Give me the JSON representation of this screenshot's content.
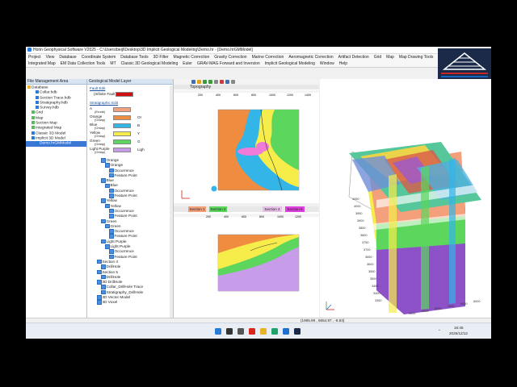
{
  "window": {
    "title": "Horin Geophysical Software V2025 - C:\\Users\\beijl\\Desktop\\3D Implicit Geological Modeling\\Demo.hr - [Demo.hrGMModel]"
  },
  "menu": {
    "row1": [
      "Project",
      "View",
      "Database",
      "Coordinate System",
      "Database Tools",
      "3D Filter",
      "Magnetic Correction",
      "Gravity Correction",
      "Marine Correction",
      "Aeromagnetic Correction",
      "Artifact Detection",
      "Grid",
      "Map",
      "Map Drawing Tools"
    ],
    "row2": [
      "Integrated Map",
      "EM Data Collection Tools",
      "MT",
      "Classic 3D Geological Modeling",
      "Euler",
      "GRAV-MAG Forward and Inversion",
      "Implicit Geological Modeling",
      "Window",
      "Help"
    ]
  },
  "file_panel": {
    "title": "File Management Area",
    "items": [
      {
        "label": "Database",
        "indent": 0,
        "icon": "folder-icon"
      },
      {
        "label": "Collar.hdb",
        "indent": 2,
        "icon": "db-icon"
      },
      {
        "label": "Section Trace.hdb",
        "indent": 2,
        "icon": "db-icon"
      },
      {
        "label": "Stratigraphy.hdb",
        "indent": 2,
        "icon": "db-icon"
      },
      {
        "label": "Survey.hdb",
        "indent": 2,
        "icon": "db-icon"
      },
      {
        "label": "Grid",
        "indent": 1,
        "icon": "grid-icon"
      },
      {
        "label": "Map",
        "indent": 1,
        "icon": "map-icon"
      },
      {
        "label": "Section Map",
        "indent": 1,
        "icon": "map-icon"
      },
      {
        "label": "Integrated Map",
        "indent": 1,
        "icon": "map-icon"
      },
      {
        "label": "Classic 3D Model",
        "indent": 1,
        "icon": "model-icon"
      },
      {
        "label": "Implicit 3D Model",
        "indent": 1,
        "icon": "model-icon"
      },
      {
        "label": "Demo.hrGMModel",
        "indent": 2,
        "icon": "model-icon",
        "selected": true
      }
    ]
  },
  "geo_panel": {
    "title": "Geological Model Layer",
    "fault_header": "Fault Edit",
    "fault_item": "(Infinite Fault)",
    "strat_header": "Stratigraphic Edit",
    "strat_rows": [
      {
        "label": "A",
        "sub": "(Erode)",
        "color": "#f4a07a",
        "right": ""
      },
      {
        "label": "Orange",
        "sub": "(Onlap)",
        "color": "#f08c40",
        "right": "Or"
      },
      {
        "label": "Blue",
        "sub": "(Onlap)",
        "color": "#33b5e8",
        "right": "B"
      },
      {
        "label": "Yellow",
        "sub": "(Onlap)",
        "color": "#f6ec4a",
        "right": "Y"
      },
      {
        "label": "Green",
        "sub": "(Onlap)",
        "color": "#5cd65c",
        "right": "G"
      },
      {
        "label": "Light Purple",
        "sub": "(Onlap)",
        "color": "#c79ce8",
        "right": "Ligh"
      }
    ],
    "tree": [
      {
        "label": "Orange",
        "indent": 1
      },
      {
        "label": "Orange",
        "indent": 2
      },
      {
        "label": "Occurrence",
        "indent": 3
      },
      {
        "label": "Feature Point",
        "indent": 3
      },
      {
        "label": "Blue",
        "indent": 1
      },
      {
        "label": "Blue",
        "indent": 2
      },
      {
        "label": "Occurrence",
        "indent": 3
      },
      {
        "label": "Feature Point",
        "indent": 3
      },
      {
        "label": "Yellow",
        "indent": 1
      },
      {
        "label": "Yellow",
        "indent": 2
      },
      {
        "label": "Occurrence",
        "indent": 3
      },
      {
        "label": "Feature Point",
        "indent": 3
      },
      {
        "label": "Green",
        "indent": 1
      },
      {
        "label": "Green",
        "indent": 2
      },
      {
        "label": "Occurrence",
        "indent": 3
      },
      {
        "label": "Feature Point",
        "indent": 3
      },
      {
        "label": "Light Purple",
        "indent": 1
      },
      {
        "label": "Light Purple",
        "indent": 2
      },
      {
        "label": "Occurrence",
        "indent": 3
      },
      {
        "label": "Feature Point",
        "indent": 3
      },
      {
        "label": "Section 4",
        "indent": 0
      },
      {
        "label": "DrillHole",
        "indent": 1
      },
      {
        "label": "Section 5",
        "indent": 0
      },
      {
        "label": "DrillHole",
        "indent": 1
      },
      {
        "label": "3D DrillHole",
        "indent": 0
      },
      {
        "label": "Collar_DrillHole Trace",
        "indent": 1
      },
      {
        "label": "Stratigraphy_DrillHole",
        "indent": 1
      },
      {
        "label": "3D Vector Model",
        "indent": 0
      },
      {
        "label": "3D Voxel",
        "indent": 0
      }
    ]
  },
  "topography": {
    "title": "Topography",
    "xticks": [
      "200",
      "400",
      "600",
      "800",
      "1000",
      "1200",
      "1400"
    ]
  },
  "sections": {
    "tabs": [
      {
        "label": "Section 1",
        "color": "#f4a07a"
      },
      {
        "label": "Section 2",
        "color": "#5cd65c"
      },
      {
        "label": "Section 4",
        "color": "#e8c0e8"
      },
      {
        "label": "Section 5",
        "color": "#e040e0"
      }
    ],
    "xticks": [
      "200",
      "400",
      "600",
      "800",
      "1000",
      "1200"
    ]
  },
  "view3d": {
    "axis_labels": [
      "4050",
      "4000",
      "3950",
      "3900",
      "3850",
      "3800",
      "3750",
      "3700",
      "3650",
      "3600",
      "3550",
      "3500",
      "3450",
      "3400",
      "3350"
    ],
    "bottom_labels": [
      "1000",
      "2000",
      "3000",
      "4000",
      "5000",
      "6000"
    ]
  },
  "status": {
    "coords": "(1965.99 , 6654.87 , -8.83)"
  },
  "taskbar": {
    "time": "16:45",
    "date": "2025/12/12"
  },
  "colors": {
    "orange": "#f08c40",
    "blue": "#33b5e8",
    "yellow": "#f6ec4a",
    "green": "#5cd65c",
    "purple": "#9b59d0",
    "light_purple": "#c79ce8",
    "pink": "#f07ad8"
  }
}
